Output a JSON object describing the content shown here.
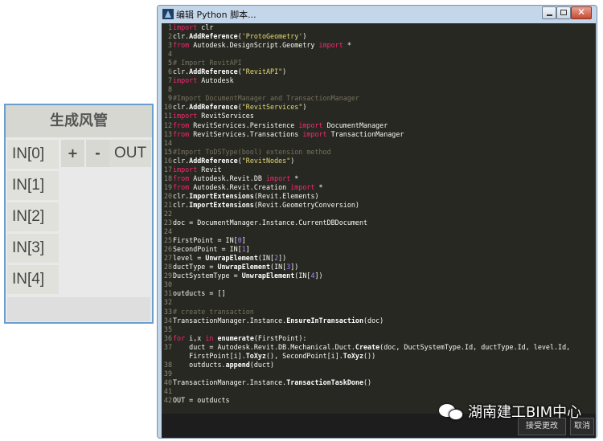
{
  "node": {
    "title": "生成风管",
    "inputs": [
      "IN[0]",
      "IN[1]",
      "IN[2]",
      "IN[3]",
      "IN[4]"
    ],
    "add_label": "+",
    "remove_label": "-",
    "output": "OUT"
  },
  "window": {
    "title": "编辑 Python 脚本...",
    "accept_label": "接受更改",
    "cancel_label": "取消"
  },
  "code_lines": [
    "import clr",
    "clr.AddReference('ProtoGeometry')",
    "from Autodesk.DesignScript.Geometry import *",
    "",
    "# Import RevitAPI",
    "clr.AddReference(\"RevitAPI\")",
    "import Autodesk",
    "",
    "#Import DocumentManager and TransactionManager",
    "clr.AddReference(\"RevitServices\")",
    "import RevitServices",
    "from RevitServices.Persistence import DocumentManager",
    "from RevitServices.Transactions import TransactionManager",
    "",
    "#Import ToDSType(bool) extension method",
    "clr.AddReference(\"RevitNodes\")",
    "import Revit",
    "from Autodesk.Revit.DB import *",
    "from Autodesk.Revit.Creation import *",
    "clr.ImportExtensions(Revit.Elements)",
    "clr.ImportExtensions(Revit.GeometryConversion)",
    "",
    "doc = DocumentManager.Instance.CurrentDBDocument",
    "",
    "FirstPoint = IN[0]",
    "SecondPoint = IN[1]",
    "level = UnwrapElement(IN[2])",
    "ductType = UnwrapElement(IN[3])",
    "DuctSystemType = UnwrapElement(IN[4])",
    "",
    "outducts = []",
    "",
    "# create transaction",
    "TransactionManager.Instance.EnsureInTransaction(doc)",
    "",
    "for i,x in enumerate(FirstPoint):",
    "    duct = Autodesk.Revit.DB.Mechanical.Duct.Create(doc, DuctSystemType.Id, ductType.Id, level.Id,",
    "    FirstPoint[i].ToXyz(), SecondPoint[i].ToXyz())",
    "    outducts.append(duct)",
    "",
    "TransactionManager.Instance.TransactionTaskDone()",
    "",
    "OUT = outducts"
  ],
  "line_numbers": [
    "1",
    "2",
    "3",
    "4",
    "5",
    "6",
    "7",
    "8",
    "9",
    "10",
    "11",
    "12",
    "13",
    "14",
    "15",
    "16",
    "17",
    "18",
    "19",
    "20",
    "21",
    "22",
    "23",
    "24",
    "25",
    "26",
    "27",
    "28",
    "29",
    "30",
    "31",
    "32",
    "33",
    "34",
    "35",
    "36",
    "37",
    "",
    "38",
    "39",
    "40",
    "41",
    "42"
  ],
  "watermark": "湖南建工BIM中心",
  "colors": {
    "editor_bg": "#272822",
    "keyword": "#f92672",
    "string": "#e6db74",
    "comment": "#75715e",
    "number": "#ae81ff",
    "node_border": "#6a9ecf"
  }
}
